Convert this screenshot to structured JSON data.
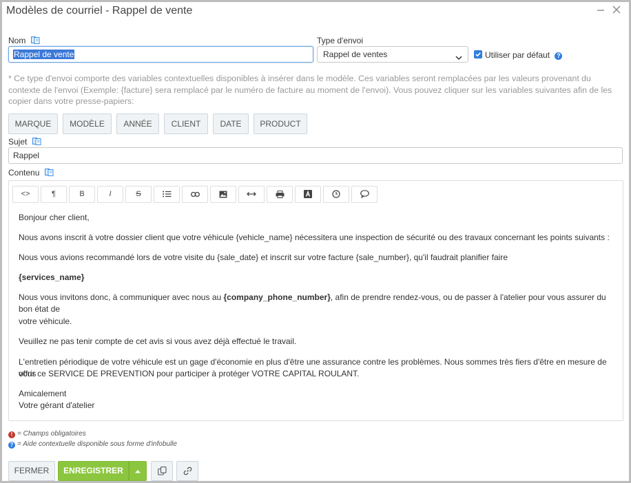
{
  "window": {
    "title": "Modèles de courriel - Rappel de vente"
  },
  "fields": {
    "nom_label": "Nom",
    "nom_value": "Rappel de vente",
    "type_label": "Type d'envoi",
    "type_value": "Rappel de ventes",
    "default_label": "Utiliser par défaut",
    "default_checked": true,
    "sujet_label": "Sujet",
    "sujet_value": "Rappel",
    "contenu_label": "Contenu"
  },
  "info_text": "* Ce type d'envoi comporte des variables contextuelles disponibles à insérer dans le modèle. Ces variables seront remplacées par les valeurs provenant du contexte de l'envoi (Exemple: {facture} sera remplacé par le numéro de facture au moment de l'envoi). Vous pouvez cliquer sur les variables suivantes afin de les copier dans votre presse-papiers:",
  "variables": [
    "MARQUE",
    "MODÈLE",
    "ANNÉE",
    "CLIENT",
    "DATE",
    "PRODUCT"
  ],
  "toolbar": {
    "code": "<>",
    "paragraph": "¶",
    "bold": "B",
    "italic": "I",
    "strike": "S"
  },
  "content": {
    "p1": "Bonjour cher client,",
    "p2": "Nous avons inscrit à votre dossier client que votre véhicule {vehicle_name} nécessitera une inspection de sécurité ou des travaux concernant les points suivants :",
    "p3": "Nous vous avions recommandé lors de votre visite du {sale_date} et inscrit sur votre facture {sale_number}, qu'il faudrait planifier faire",
    "p4": "{services_name}",
    "p5a": "Nous vous invitons donc, à communiquer avec nous au ",
    "p5b": "{company_phone_number}",
    "p5c": ", afin de prendre rendez-vous, ou de passer à l'atelier pour vous assurer du bon état de",
    "p5d": "votre véhicule.",
    "p6": "Veuillez ne pas tenir compte de cet avis si vous avez déjà effectué le travail.",
    "p7a": "L'entretien périodique de votre véhicule est un gage d'économie en plus d'être une assurance contre les problèmes. Nous sommes très fiers d'être en mesure de vous",
    "p7b": "offrir ce SERVICE DE PREVENTION pour participer à protéger VOTRE CAPITAL ROULANT.",
    "p8a": "Amicalement",
    "p8b": "Votre gérant d'atelier"
  },
  "legend": {
    "required": "= Champs obligatoires",
    "help": "= Aide contextuelle disponible sous forme d'infobulle"
  },
  "footer": {
    "close": "FERMER",
    "save": "ENREGISTRER"
  },
  "colors": {
    "accent": "#2f7fe0",
    "save": "#8cc63f",
    "required": "#c0392b"
  }
}
